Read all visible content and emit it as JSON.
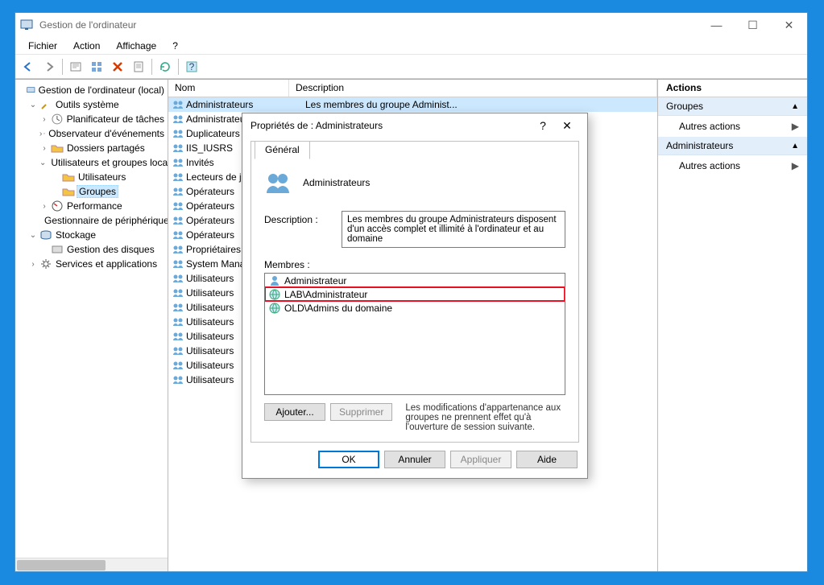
{
  "window": {
    "title": "Gestion de l'ordinateur",
    "minimize": "—",
    "maximize": "☐",
    "close": "✕"
  },
  "menubar": {
    "file": "Fichier",
    "action": "Action",
    "display": "Affichage",
    "help": "?"
  },
  "tree": {
    "root": "Gestion de l'ordinateur (local)",
    "system_tools": "Outils système",
    "scheduler": "Planificateur de tâches",
    "event_viewer": "Observateur d'événements",
    "shared_folders": "Dossiers partagés",
    "users_groups": "Utilisateurs et groupes locaux",
    "users": "Utilisateurs",
    "groups": "Groupes",
    "performance": "Performance",
    "device_mgr": "Gestionnaire de périphériques",
    "storage": "Stockage",
    "disk_mgmt": "Gestion des disques",
    "services_apps": "Services et applications"
  },
  "list": {
    "col_name": "Nom",
    "col_desc": "Description",
    "rows": [
      {
        "name": "Administrateurs",
        "desc": "Les membres du groupe Administ..."
      },
      {
        "name": "Administrateurs",
        "desc": ""
      },
      {
        "name": "Duplicateurs",
        "desc": ""
      },
      {
        "name": "IIS_IUSRS",
        "desc": ""
      },
      {
        "name": "Invités",
        "desc": ""
      },
      {
        "name": "Lecteurs de journaux",
        "desc": ""
      },
      {
        "name": "Opérateurs",
        "desc": ""
      },
      {
        "name": "Opérateurs",
        "desc": ""
      },
      {
        "name": "Opérateurs",
        "desc": ""
      },
      {
        "name": "Opérateurs",
        "desc": ""
      },
      {
        "name": "Propriétaires",
        "desc": ""
      },
      {
        "name": "System Managed",
        "desc": ""
      },
      {
        "name": "Utilisateurs",
        "desc": ""
      },
      {
        "name": "Utilisateurs",
        "desc": ""
      },
      {
        "name": "Utilisateurs",
        "desc": ""
      },
      {
        "name": "Utilisateurs",
        "desc": ""
      },
      {
        "name": "Utilisateurs",
        "desc": ""
      },
      {
        "name": "Utilisateurs",
        "desc": ""
      },
      {
        "name": "Utilisateurs",
        "desc": ""
      },
      {
        "name": "Utilisateurs",
        "desc": ""
      }
    ]
  },
  "actions": {
    "header": "Actions",
    "section1": "Groupes",
    "other1": "Autres actions",
    "section2": "Administrateurs",
    "other2": "Autres actions"
  },
  "dialog": {
    "title": "Propriétés de : Administrateurs",
    "help": "?",
    "close": "✕",
    "tab_general": "Général",
    "group_name": "Administrateurs",
    "desc_label": "Description :",
    "desc_value": "Les membres du groupe Administrateurs disposent d'un accès complet et illimité à l'ordinateur et au domaine",
    "members_label": "Membres :",
    "members": [
      {
        "name": "Administrateur",
        "highlight": false
      },
      {
        "name": "LAB\\Administrateur",
        "highlight": true
      },
      {
        "name": "OLD\\Admins du domaine",
        "highlight": false
      }
    ],
    "btn_add": "Ajouter...",
    "btn_remove": "Supprimer",
    "note": "Les modifications d'appartenance aux groupes ne prennent effet qu'à l'ouverture de session suivante.",
    "btn_ok": "OK",
    "btn_cancel": "Annuler",
    "btn_apply": "Appliquer",
    "btn_help": "Aide"
  }
}
